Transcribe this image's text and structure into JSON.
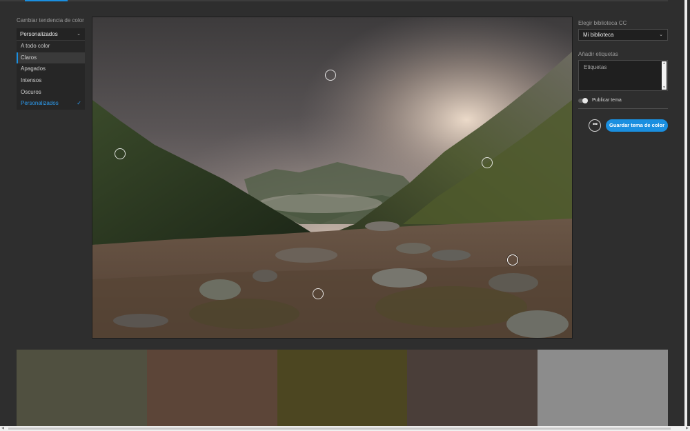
{
  "left_panel": {
    "title": "Cambiar tendencia de color",
    "selected": "Personalizados",
    "items": [
      {
        "label": "A todo color"
      },
      {
        "label": "Claros"
      },
      {
        "label": "Apagados"
      },
      {
        "label": "Intensos"
      },
      {
        "label": "Oscuros"
      },
      {
        "label": "Personalizados",
        "check": "✓"
      }
    ]
  },
  "right_panel": {
    "library_label": "Elegir biblioteca CC",
    "library_value": "Mi biblioteca",
    "tags_label": "Añadir etiquetas",
    "tags_placeholder": "Etiquetas",
    "publish_label": "Publicar tema",
    "more_icon": "•••",
    "save_label": "Guardar tema de color"
  },
  "colors": {
    "accent": "#1a8fe0",
    "background": "#2e2e2e"
  },
  "swatches": [
    "#505040",
    "#5c4538",
    "#4c4621",
    "#4a3e39",
    "#8c8c8c"
  ]
}
